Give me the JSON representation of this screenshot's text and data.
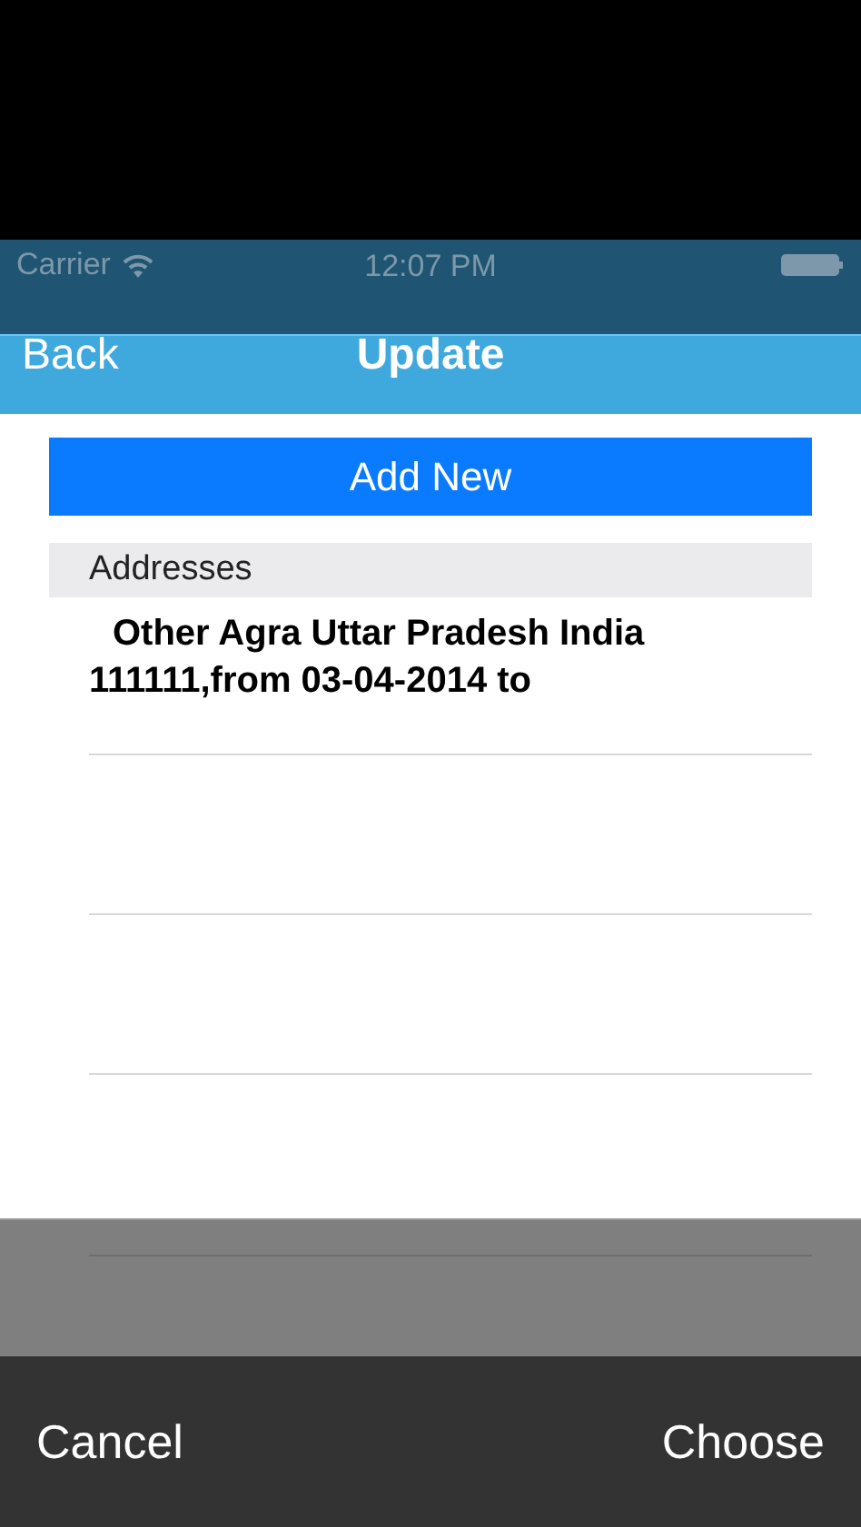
{
  "status_bar": {
    "carrier": "Carrier",
    "time": "12:07 PM"
  },
  "nav_bar": {
    "back": "Back",
    "title": "Update"
  },
  "add_button": "Add New",
  "section_header": "Addresses",
  "addresses": [
    {
      "text": "Other Agra Uttar Pradesh India 111111,from 03-04-2014 to"
    }
  ],
  "picker_toolbar": {
    "cancel": "Cancel",
    "choose": "Choose"
  }
}
